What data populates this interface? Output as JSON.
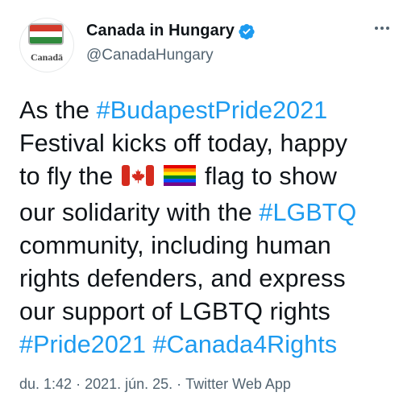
{
  "account": {
    "display_name": "Canada in Hungary",
    "handle": "@CanadaHungary",
    "avatar_wordmark": "Canadä"
  },
  "tweet": {
    "line1_pre": "As the ",
    "hashtag_budapest": "#BudapestPride2021",
    "line2": "Festival kicks off today, happy",
    "line3_pre": "to fly the",
    "line3_post": "flag to show",
    "line4_pre": "our solidarity with the ",
    "hashtag_lgbtq": "#LGBTQ",
    "line5": "community, including human",
    "line6": "rights defenders, and express",
    "line7": "our support of LGBTQ rights",
    "hashtag_pride": "#Pride2021",
    "hashtag_canada4rights": "#Canada4Rights"
  },
  "meta": {
    "time": "du. 1:42",
    "date": "2021. jún. 25.",
    "source": "Twitter Web App",
    "separator": "·"
  },
  "icons": {
    "verified": "verified-badge-icon",
    "more": "more-options-icon",
    "canada_flag": "canada-flag-emoji",
    "rainbow_flag": "rainbow-flag-emoji"
  },
  "colors": {
    "link": "#1d9bf0",
    "secondary": "#536471",
    "text": "#0f1419"
  }
}
